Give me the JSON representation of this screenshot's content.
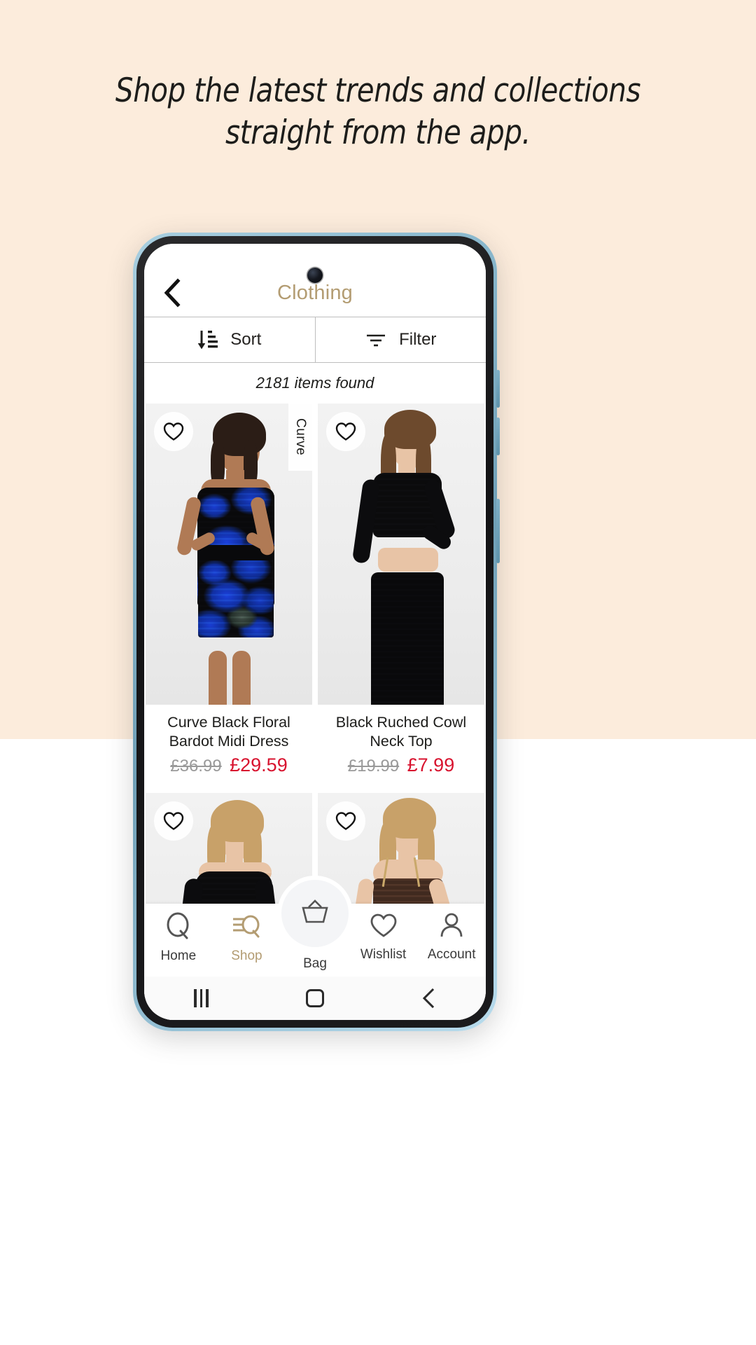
{
  "page": {
    "background_top": "#fcecdc",
    "background_bottom": "#ffffff",
    "headline_line1": "Shop the latest trends and collections",
    "headline_line2": "straight from the app."
  },
  "app": {
    "header": {
      "back_icon": "chevron-left-icon",
      "title": "Clothing",
      "title_color": "#b39c72"
    },
    "toolbar": {
      "sort_label": "Sort",
      "sort_icon": "sort-descending-icon",
      "filter_label": "Filter",
      "filter_icon": "filter-funnel-icon"
    },
    "results": {
      "count_text": "2181 items found"
    },
    "products": [
      {
        "title": "Curve Black Floral Bardot Midi Dress",
        "price_was": "£36.99",
        "price_now": "£29.59",
        "badge": "Curve",
        "wishlist_icon": "heart-outline-icon"
      },
      {
        "title": "Black Ruched Cowl Neck Top",
        "price_was": "£19.99",
        "price_now": "£7.99",
        "badge": "",
        "wishlist_icon": "heart-outline-icon"
      },
      {
        "title": "",
        "price_was": "",
        "price_now": "",
        "badge": "",
        "wishlist_icon": "heart-outline-icon"
      },
      {
        "title": "",
        "price_was": "",
        "price_now": "",
        "badge": "",
        "wishlist_icon": "heart-outline-icon"
      }
    ],
    "bottom_nav": {
      "active": "Shop",
      "active_color": "#b39c72",
      "items": [
        {
          "label": "Home",
          "icon": "quiz-q-logo-icon"
        },
        {
          "label": "Shop",
          "icon": "shop-search-icon"
        },
        {
          "label": "Bag",
          "icon": "shopping-basket-icon"
        },
        {
          "label": "Wishlist",
          "icon": "heart-outline-icon"
        },
        {
          "label": "Account",
          "icon": "person-outline-icon"
        }
      ]
    },
    "system_bar": {
      "recents_icon": "recents-bars-icon",
      "home_icon": "home-square-icon",
      "back_icon": "chevron-left-icon"
    }
  },
  "prices": {
    "sale_color": "#d8132f",
    "was_color": "#9a9a9a"
  }
}
